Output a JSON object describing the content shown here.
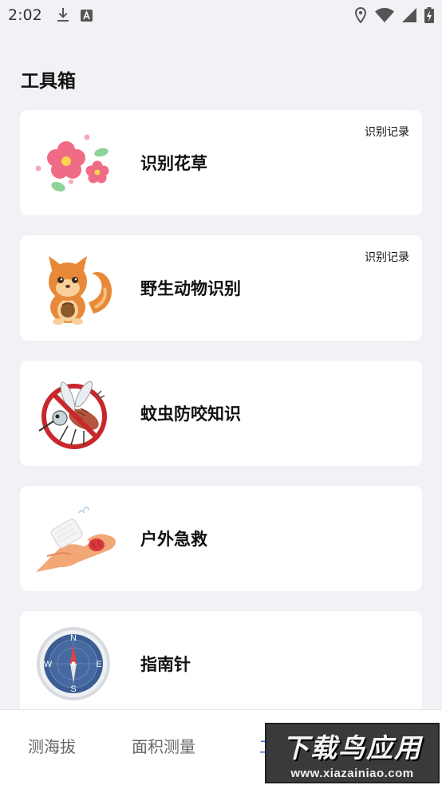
{
  "status_bar": {
    "time": "2:02",
    "icons": [
      "download-icon",
      "font-a-icon",
      "location-icon",
      "wifi-icon",
      "signal-icon",
      "battery-charging-icon"
    ]
  },
  "page": {
    "title": "工具箱"
  },
  "tools": [
    {
      "label": "识别花草",
      "history": "识别记录",
      "illustration": "flower-icon"
    },
    {
      "label": "野生动物识别",
      "history": "识别记录",
      "illustration": "squirrel-icon"
    },
    {
      "label": "蚊虫防咬知识",
      "illustration": "no-mosquito-icon"
    },
    {
      "label": "户外急救",
      "illustration": "bandage-hand-icon"
    },
    {
      "label": "指南针",
      "illustration": "compass-icon"
    }
  ],
  "bottom_nav": {
    "items": [
      "测海拔",
      "面积测量",
      "工"
    ],
    "active_color": "#3b6fd8"
  },
  "watermark": {
    "text": "下载鸟应用",
    "url": "www.xiazainiao.com"
  }
}
